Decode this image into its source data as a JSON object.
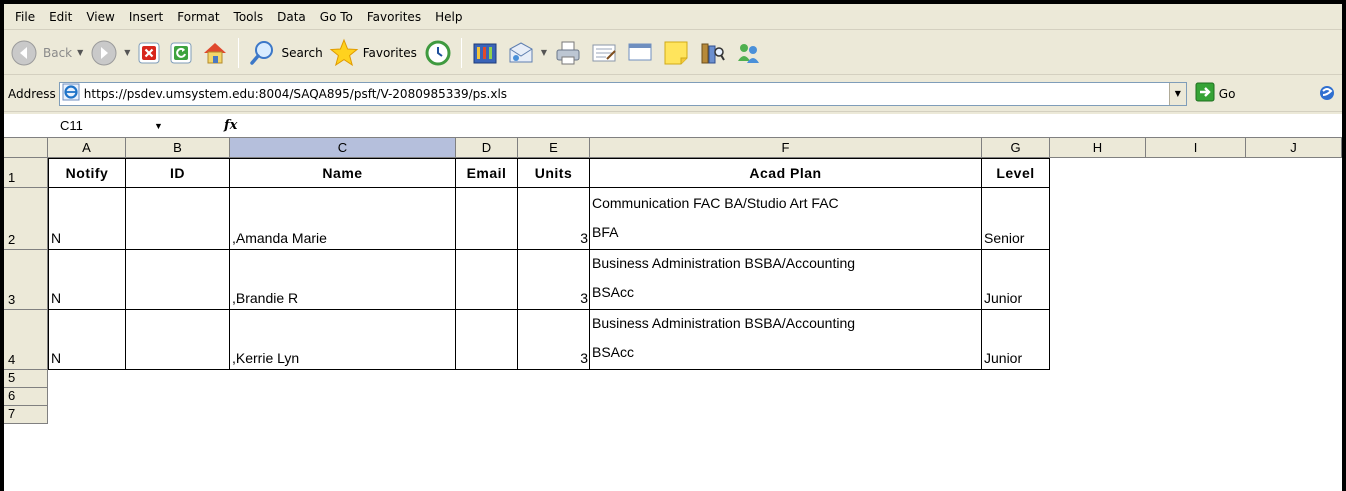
{
  "menu": [
    "File",
    "Edit",
    "View",
    "Insert",
    "Format",
    "Tools",
    "Data",
    "Go To",
    "Favorites",
    "Help"
  ],
  "toolbar": {
    "back_label": "Back",
    "search_label": "Search",
    "favorites_label": "Favorites"
  },
  "address": {
    "label": "Address",
    "url": "https://psdev.umsystem.edu:8004/SAQA895/psft/V-2080985339/ps.xls",
    "go_label": "Go"
  },
  "formula_bar": {
    "cell_ref": "C11",
    "fx_symbol": "fx",
    "content": ""
  },
  "sheet": {
    "columns": [
      "A",
      "B",
      "C",
      "D",
      "E",
      "F",
      "G",
      "H",
      "I",
      "J"
    ],
    "selected_column": "C",
    "row_numbers": [
      "1",
      "2",
      "3",
      "4",
      "5",
      "6",
      "7"
    ],
    "headers": [
      "Notify",
      "ID",
      "Name",
      "Email",
      "Units",
      "Acad Plan",
      "Level"
    ],
    "rows": [
      {
        "notify": "N",
        "id": "",
        "name": ",Amanda Marie",
        "email": "",
        "units": "3",
        "plan_line1": "Communication FAC BA/Studio Art FAC",
        "plan_line2": "BFA",
        "level": "Senior"
      },
      {
        "notify": "N",
        "id": "",
        "name": ",Brandie R",
        "email": "",
        "units": "3",
        "plan_line1": "Business Administration BSBA/Accounting",
        "plan_line2": "BSAcc",
        "level": "Junior"
      },
      {
        "notify": "N",
        "id": "",
        "name": ",Kerrie Lyn",
        "email": "",
        "units": "3",
        "plan_line1": "Business Administration BSBA/Accounting",
        "plan_line2": "BSAcc",
        "level": "Junior"
      }
    ]
  },
  "colors": {
    "chrome": "#ece9d8",
    "selected_header": "#b5bfdc",
    "address_border": "#7f9db9"
  }
}
